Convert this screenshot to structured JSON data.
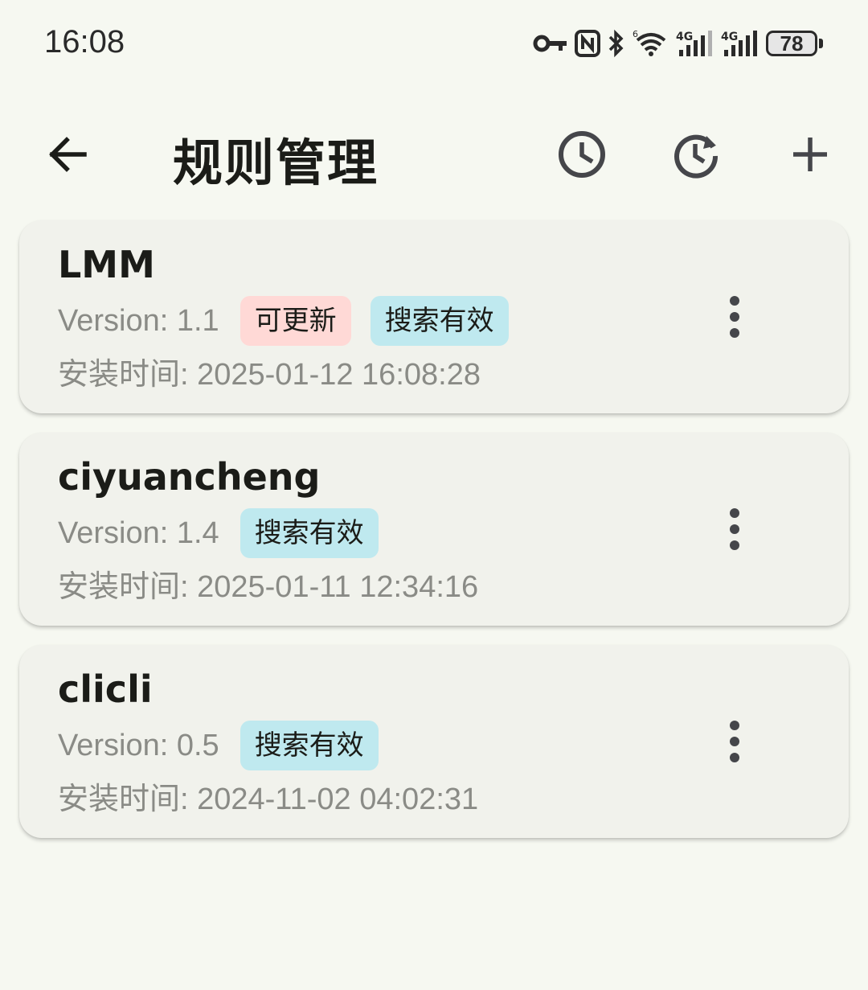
{
  "status_bar": {
    "time": "16:08",
    "battery": "78",
    "icons": [
      "key-icon",
      "nfc-icon",
      "bluetooth-icon",
      "wifi-icon",
      "signal-4g-icon",
      "signal-4g-icon",
      "battery-icon"
    ]
  },
  "app_bar": {
    "title": "规则管理",
    "icons": [
      "back-arrow-icon",
      "history-icon",
      "update-icon",
      "add-icon"
    ]
  },
  "rules": [
    {
      "name": "LMM",
      "version": "Version: 1.1",
      "tags": [
        "可更新",
        "搜索有效"
      ],
      "install_time": "安装时间: 2025-01-12 16:08:28"
    },
    {
      "name": "ciyuancheng",
      "version": "Version: 1.4",
      "tags": [
        "搜索有效"
      ],
      "install_time": "安装时间: 2025-01-11 12:34:16"
    },
    {
      "name": "clicli",
      "version": "Version: 0.5",
      "tags": [
        "搜索有效"
      ],
      "install_time": "安装时间: 2024-11-02 04:02:31"
    }
  ],
  "colors": {
    "background": "#f6f8f1",
    "card": "#f1f2ec",
    "tag_update": "#ffd9d6",
    "tag_search": "#bfe9ef",
    "secondary_text": "#8a8b86"
  }
}
